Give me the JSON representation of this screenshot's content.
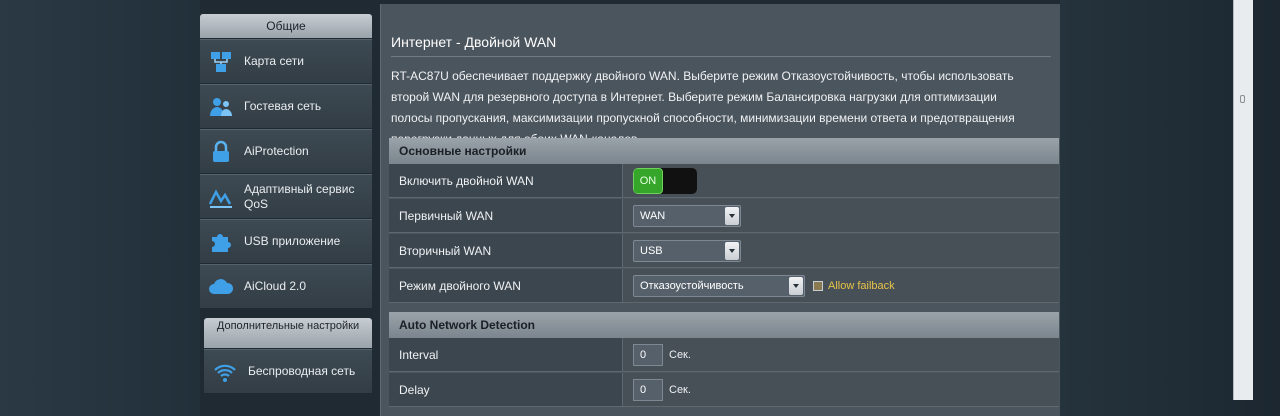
{
  "sidebar": {
    "header": "Общие",
    "items": [
      {
        "label": "Карта сети",
        "icon": "network-map-icon"
      },
      {
        "label": "Гостевая сеть",
        "icon": "guest-network-icon"
      },
      {
        "label": "AiProtection",
        "icon": "lock-icon"
      },
      {
        "label": "Адаптивный сервис QoS",
        "icon": "qos-icon"
      },
      {
        "label": "USB приложение",
        "icon": "puzzle-icon"
      },
      {
        "label": "AiCloud 2.0",
        "icon": "cloud-icon"
      }
    ],
    "group_header": "Дополнительные настройки",
    "sub_items": [
      {
        "label": "Беспроводная сеть",
        "icon": "wifi-icon"
      }
    ]
  },
  "main": {
    "title": "Интернет - Двойной WAN",
    "description": "RT-AC87U обеспечивает поддержку двойного WAN. Выберите режим Отказоустойчивость, чтобы использовать второй WAN для резервного доступа в Интернет. Выберите режим Балансировка нагрузки для оптимизации полосы пропускания, максимизации пропускной способности, минимизации времени ответа и предотвращения перегрузки данных для обоих WAN-каналов.",
    "basic_section": {
      "title": "Основные настройки",
      "rows": [
        {
          "label": "Включить двойной WAN",
          "toggle_label": "ON"
        },
        {
          "label": "Первичный WAN",
          "value": "WAN"
        },
        {
          "label": "Вторичный WAN",
          "value": "USB"
        },
        {
          "label": "Режим двойного WAN",
          "value": "Отказоустойчивость",
          "checkbox_label": "Allow failback"
        }
      ]
    },
    "detect_section": {
      "title": "Auto Network Detection",
      "rows": [
        {
          "label": "Interval",
          "value": "0",
          "unit": "Сек."
        },
        {
          "label": "Delay",
          "value": "0",
          "unit": "Сек."
        }
      ]
    }
  },
  "colors": {
    "accent_green": "#35a629",
    "help_yellow": "#e8c449"
  }
}
